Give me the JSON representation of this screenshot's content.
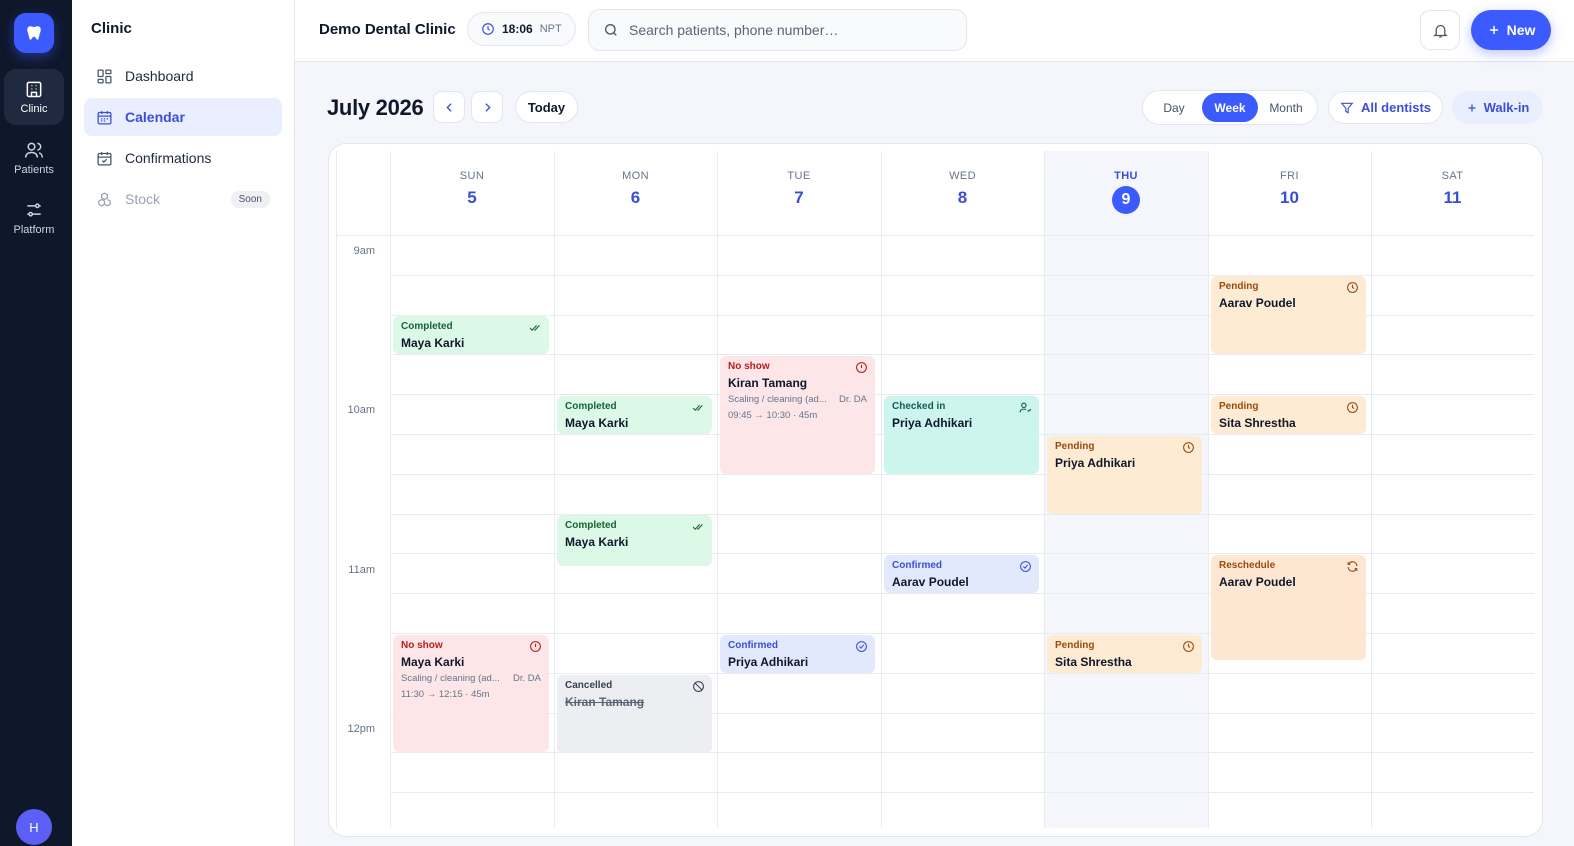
{
  "rail": {
    "items": [
      {
        "label": "Clinic",
        "icon": "building-icon"
      },
      {
        "label": "Patients",
        "icon": "users-icon"
      },
      {
        "label": "Platform",
        "icon": "sliders-icon"
      }
    ],
    "avatar": "H"
  },
  "sidebar": {
    "title": "Clinic",
    "items": [
      {
        "label": "Dashboard",
        "icon": "grid-icon"
      },
      {
        "label": "Calendar",
        "icon": "calendar-icon"
      },
      {
        "label": "Confirmations",
        "icon": "calendar-check-icon"
      },
      {
        "label": "Stock",
        "icon": "boxes-icon",
        "badge": "Soon"
      }
    ]
  },
  "topbar": {
    "clinic_name": "Demo Dental Clinic",
    "time": "18:06",
    "timezone": "NPT",
    "search_placeholder": "Search patients, phone number…",
    "new_label": "New"
  },
  "toolbar": {
    "month_title": "July 2026",
    "today_label": "Today",
    "views": [
      "Day",
      "Week",
      "Month"
    ],
    "active_view": "Week",
    "filter_label": "All dentists",
    "walkin_label": "Walk-in"
  },
  "calendar": {
    "days": [
      {
        "name": "SUN",
        "num": "5"
      },
      {
        "name": "MON",
        "num": "6"
      },
      {
        "name": "TUE",
        "num": "7"
      },
      {
        "name": "WED",
        "num": "8"
      },
      {
        "name": "THU",
        "num": "9"
      },
      {
        "name": "FRI",
        "num": "10"
      },
      {
        "name": "SAT",
        "num": "11"
      }
    ],
    "today_index": 4,
    "time_labels": [
      "9am",
      "10am",
      "11am",
      "12pm"
    ],
    "appointments": [
      {
        "status": "Completed",
        "name": "Maya Karki"
      },
      {
        "status": "Completed",
        "name": "Maya Karki"
      },
      {
        "status": "Completed",
        "name": "Maya Karki"
      },
      {
        "status": "No show",
        "name": "Maya Karki",
        "service": "Scaling / cleaning (ad...",
        "dentist": "Dr. DA",
        "time": "11:30 → 12:15 · 45m"
      },
      {
        "status": "No show",
        "name": "Kiran Tamang",
        "service": "Scaling / cleaning (ad...",
        "dentist": "Dr. DA",
        "time": "09:45 → 10:30 · 45m"
      },
      {
        "status": "Confirmed",
        "name": "Priya Adhikari"
      },
      {
        "status": "Cancelled",
        "name": "Kiran Tamang"
      },
      {
        "status": "Checked in",
        "name": "Priya Adhikari"
      },
      {
        "status": "Confirmed",
        "name": "Aarav Poudel"
      },
      {
        "status": "Pending",
        "name": "Priya Adhikari"
      },
      {
        "status": "Pending",
        "name": "Sita Shrestha"
      },
      {
        "status": "Pending",
        "name": "Aarav Poudel"
      },
      {
        "status": "Pending",
        "name": "Sita Shrestha"
      },
      {
        "status": "Reschedule",
        "name": "Aarav Poudel"
      }
    ]
  },
  "colors": {
    "accent": "#3b5bff",
    "rail_bg": "#0f172a",
    "completed": "#dcf8e6",
    "no_show": "#fde6e8",
    "checked_in": "#ccf5ee",
    "pending": "#fdebd3",
    "confirmed": "#e3e9fd",
    "cancelled": "#eceef2"
  }
}
